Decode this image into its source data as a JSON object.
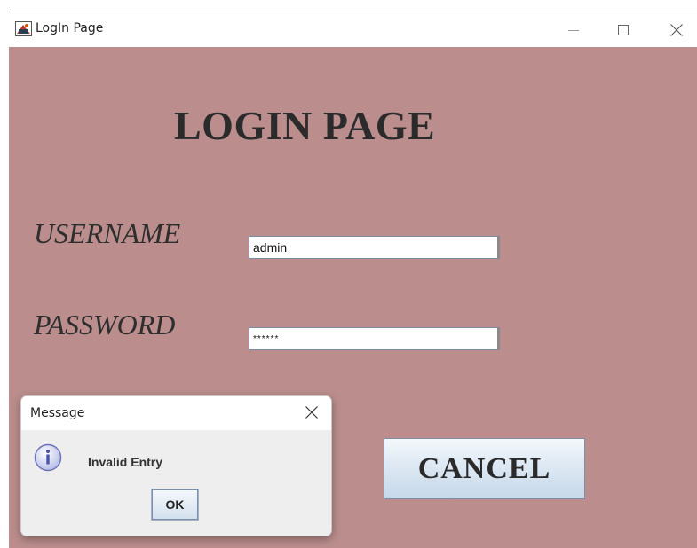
{
  "window": {
    "title": "LogIn Page",
    "icon": "java-cup-icon",
    "controls": [
      "minimize-icon",
      "maximize-icon",
      "close-icon"
    ]
  },
  "form": {
    "heading": "LOGIN PAGE",
    "username_label": "USERNAME",
    "username_value": "admin",
    "password_label": "PASSWORD",
    "password_value": "******",
    "cancel_label": "CANCEL"
  },
  "dialog": {
    "title": "Message",
    "icon": "info-icon",
    "message": "Invalid Entry",
    "ok_label": "OK"
  },
  "colors": {
    "content_background": "#bb8e8d",
    "button_gradient_top": "#f4f8fc",
    "button_gradient_bottom": "#c6d8ea"
  }
}
